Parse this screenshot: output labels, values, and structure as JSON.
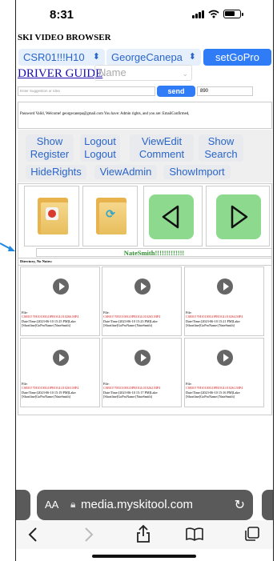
{
  "status": {
    "time": "8:31"
  },
  "app": {
    "title": "SKI VIDEO BROWSER"
  },
  "controls": {
    "device_select": "CSR01!!!H10",
    "user_select": "GeorgeCanepa",
    "gopro_button": "setGoPro",
    "guide_link": "DRIVER GUIDE",
    "name_placeholder": "Name",
    "suggestion_placeholder": "Enter Suggestion or Idea",
    "send_button": "send",
    "count_value": "890"
  },
  "welcome_text": "Password Valid, Welcome! georgecanepa@gmail.com You have: Admin rights, and you are: EmailConfirmed,",
  "menu": {
    "show_register": "Show Register",
    "logout": "Logout Logout",
    "view_edit_comment": "ViewEdit Comment",
    "show_search": "Show Search",
    "hide_rights": "HideRights",
    "view_admin": "ViewAdmin",
    "show_import": "ShowImport"
  },
  "user_banner": "NateSmith!!!!!!!!!!!!!",
  "directory_label": "Directory, No Notes:",
  "videos": [
    {
      "file_label": "File:",
      "file": "CSR01!!!H10100GOPROGL010266.MP4",
      "meta": "Date/Time:[2023-06-10 15:25 PM]Lake:[Shortline]GoProName:[NateSmith]"
    },
    {
      "file_label": "File:",
      "file": "CSR01!!!H10100GOPROGL010265.MP4",
      "meta": "Date/Time:[2023-06-10 15:23 PM]Lake:[Shortline]GoProName:[NateSmith]"
    },
    {
      "file_label": "File:",
      "file": "CSR01!!!H10100GOPROGL010264.MP4",
      "meta": "Date/Time:[2023-06-10 15:21 PM]Lake:[Shortline]GoProName:[NateSmith]"
    },
    {
      "file_label": "File:",
      "file": "CSR01!!!H10100GOPROGL010263.MP4",
      "meta": "Date/Time:[2023-06-10 15:19 PM]Lake:[Shortline]GoProName:[NateSmith]"
    },
    {
      "file_label": "File:",
      "file": "CSR01!!!H10100GOPROGL010262.MP4",
      "meta": "Date/Time:[2023-06-10 15:17 PM]Lake:[Shortline]GoProName:[NateSmith]"
    },
    {
      "file_label": "File:",
      "file": "CSR01!!!H10100GOPROGL010261.MP4",
      "meta": "Date/Time:[2023-06-10 15:16 PM]Lake:[Shortline]GoProName:[NateSmith]"
    }
  ],
  "browser": {
    "aa": "AA",
    "url": "media.myskitool.com"
  },
  "colors": {
    "accent": "#2f7cf6",
    "nav_green": "#8dd98d",
    "user_green": "#2f8f2f",
    "file_red": "#d42020"
  },
  "icons": [
    "signal-icon",
    "wifi-icon",
    "battery-icon",
    "record-icon",
    "sync-icon",
    "left-arrow-icon",
    "right-arrow-icon",
    "play-icon",
    "lock-icon",
    "reload-icon",
    "back-icon",
    "forward-icon",
    "share-icon",
    "bookmarks-icon",
    "tabs-icon"
  ]
}
